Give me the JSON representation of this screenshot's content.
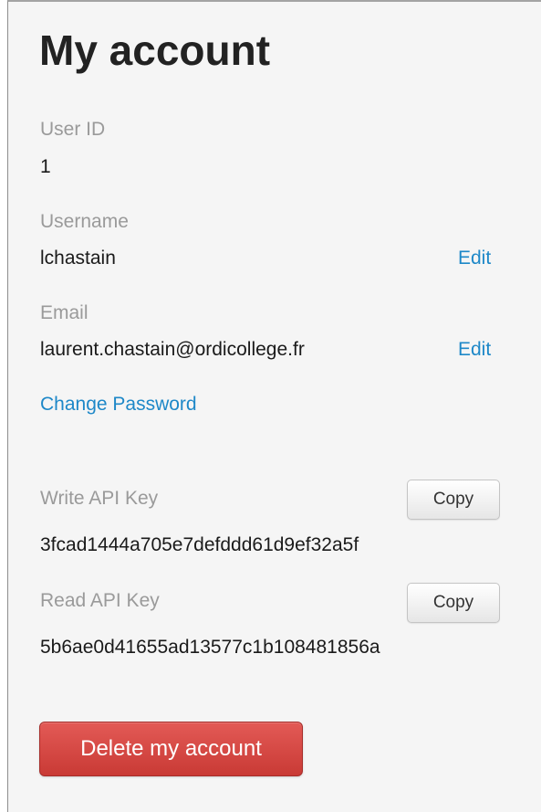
{
  "account": {
    "title": "My account",
    "user_id": {
      "label": "User ID",
      "value": "1"
    },
    "username": {
      "label": "Username",
      "value": "lchastain",
      "edit_label": "Edit"
    },
    "email": {
      "label": "Email",
      "value": "laurent.chastain@ordicollege.fr",
      "edit_label": "Edit"
    },
    "change_password_label": "Change Password",
    "write_api_key": {
      "label": "Write API Key",
      "value": "3fcad1444a705e7defddd61d9ef32a5f",
      "copy_label": "Copy"
    },
    "read_api_key": {
      "label": "Read API Key",
      "value": "5b6ae0d41655ad13577c1b108481856a",
      "copy_label": "Copy"
    },
    "delete_label": "Delete my account"
  },
  "colors": {
    "link": "#1e88c8",
    "danger": "#d9534f",
    "label": "#9a9a9a",
    "panel_bg": "#f5f5f5"
  }
}
